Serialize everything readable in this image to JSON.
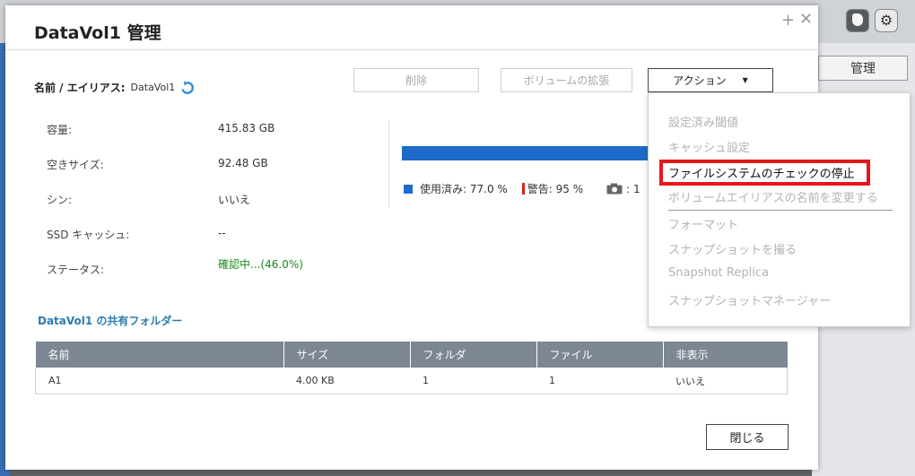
{
  "dialog": {
    "title": "DataVol1 管理"
  },
  "alias": {
    "label": "名前 / エイリアス:",
    "value": "DataVol1"
  },
  "buttons": {
    "delete": "削除",
    "expand": "ボリュームの拡張",
    "action": "アクション",
    "close": "閉じる"
  },
  "info": [
    {
      "label": "容量:",
      "value": "415.83 GB"
    },
    {
      "label": "空きサイズ:",
      "value": "92.48 GB"
    },
    {
      "label": "シン:",
      "value": "いいえ"
    },
    {
      "label": "SSD キャッシュ:",
      "value": "--"
    },
    {
      "label": "ステータス:",
      "value": "確認中...(46.0%)"
    }
  ],
  "usage": {
    "used_label": "使用済み: 77.0 %",
    "warning_label": "警告: 95 %",
    "snapshot_count": ": 1",
    "used_fraction": 0.77,
    "bar_color": "#1e6ac9",
    "warning_color": "#d9241c"
  },
  "shared_folders": {
    "title": "DataVol1 の共有フォルダー",
    "columns": [
      "名前",
      "サイズ",
      "フォルダ",
      "ファイル",
      "非表示"
    ],
    "rows": [
      [
        "A1",
        "4.00 KB",
        "1",
        "1",
        "いいえ"
      ]
    ]
  },
  "action_menu": {
    "items": [
      {
        "label": "設定済み閾値",
        "enabled": false
      },
      {
        "label": "キャッシュ設定",
        "enabled": false
      },
      {
        "label": "ファイルシステムのチェックの停止",
        "enabled": true,
        "highlighted": true
      },
      {
        "label": "ボリュームエイリアスの名前を変更する",
        "enabled": false
      },
      {
        "label": "フォーマット",
        "enabled": false
      },
      {
        "label": "スナップショットを撮る",
        "enabled": false
      },
      {
        "label": "Snapshot Replica",
        "enabled": false
      },
      {
        "label": "スナップショットマネージャー",
        "enabled": false
      }
    ],
    "highlight_color": "#e8151b"
  },
  "background": {
    "manage_button": "管理"
  }
}
